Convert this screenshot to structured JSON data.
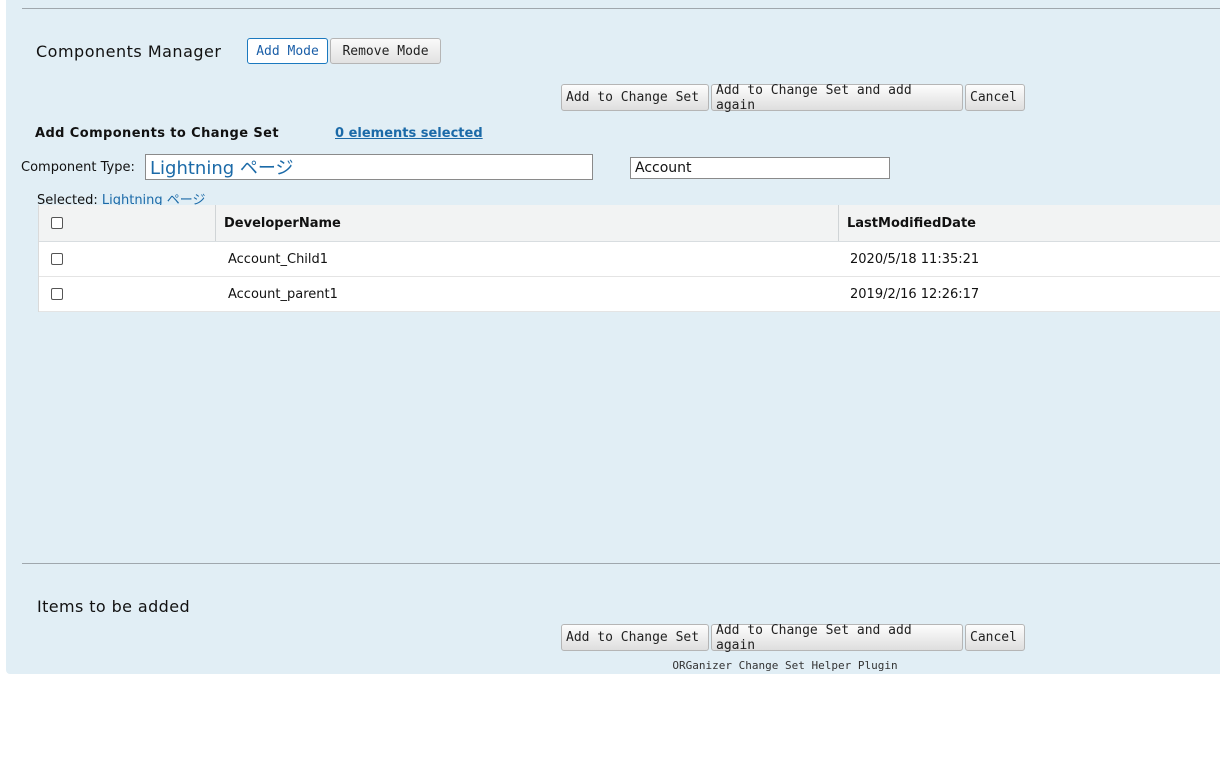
{
  "header": {
    "title": "Components Manager",
    "add_mode": "Add Mode",
    "remove_mode": "Remove Mode"
  },
  "actions": {
    "add_to_change_set": "Add to Change Set",
    "add_again": "Add to Change Set and add again",
    "cancel": "Cancel"
  },
  "add_section": {
    "title": "Add Components to Change Set",
    "selected_count_link": "0 elements selected",
    "component_type_label": "Component Type:",
    "component_type_value": "Lightning ページ",
    "filter_value": "Account",
    "selected_label": "Selected:",
    "selected_value": "Lightning ページ"
  },
  "table": {
    "columns": [
      "",
      "DeveloperName",
      "LastModifiedDate"
    ],
    "rows": [
      {
        "name": "Account_Child1",
        "date": "2020/5/18 11:35:21"
      },
      {
        "name": "Account_parent1",
        "date": "2019/2/16 12:26:17"
      }
    ]
  },
  "items_section": {
    "title": "Items to be added"
  },
  "footer": {
    "text": "ORGanizer Change Set Helper Plugin"
  }
}
